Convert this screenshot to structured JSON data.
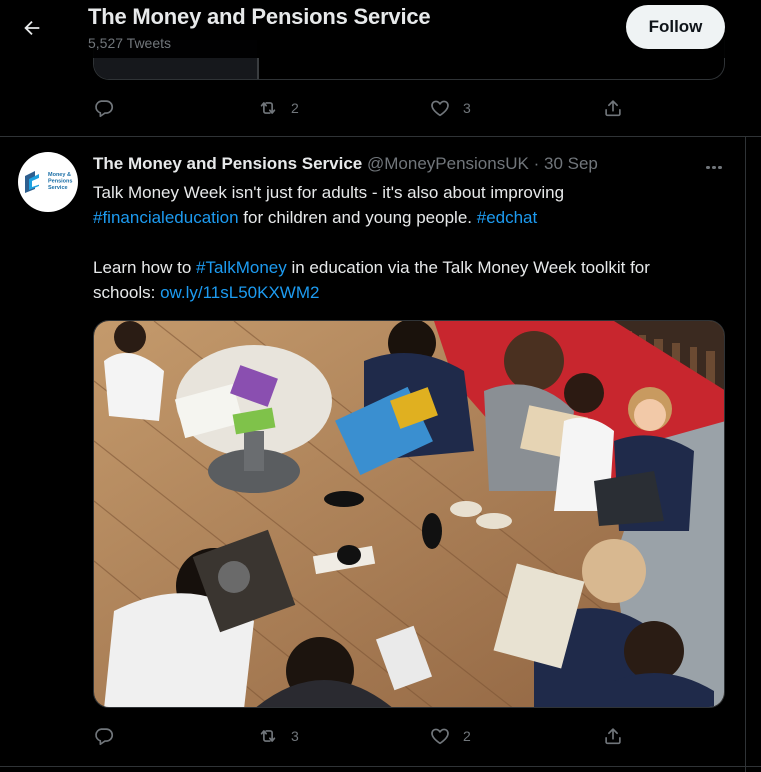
{
  "header": {
    "title": "The Money and Pensions Service",
    "tweet_count": "5,527 Tweets",
    "follow_label": "Follow"
  },
  "previous_tweet": {
    "reply_count": "",
    "retweet_count": "2",
    "like_count": "3"
  },
  "tweet": {
    "author_name": "The Money and Pensions Service",
    "handle": "@MoneyPensionsUK",
    "separator": "·",
    "date": "30 Sep",
    "avatar_logo_text": "Money & Pensions Service",
    "text": {
      "line1": "Talk Money Week isn't just for adults - it's also about improving",
      "hashtag1": "#financialeducation",
      "line2_mid": " for children and young people. ",
      "hashtag2": "#edchat",
      "line3_start": "Learn how to ",
      "hashtag3": "#TalkMoney",
      "line3_end": " in education via the Talk Money Week toolkit for",
      "line4_start": "schools: ",
      "link": "ow.ly/11sL50KXWM2"
    },
    "reply_count": "",
    "retweet_count": "3",
    "like_count": "2"
  },
  "colors": {
    "background": "#000000",
    "text": "#e7e9ea",
    "secondary": "#71767b",
    "link": "#1d9bf0",
    "border": "#2f3336",
    "follow_bg": "#eff3f4"
  },
  "icons": [
    "back-arrow-icon",
    "reply-icon",
    "retweet-icon",
    "like-icon",
    "share-icon",
    "more-icon"
  ]
}
